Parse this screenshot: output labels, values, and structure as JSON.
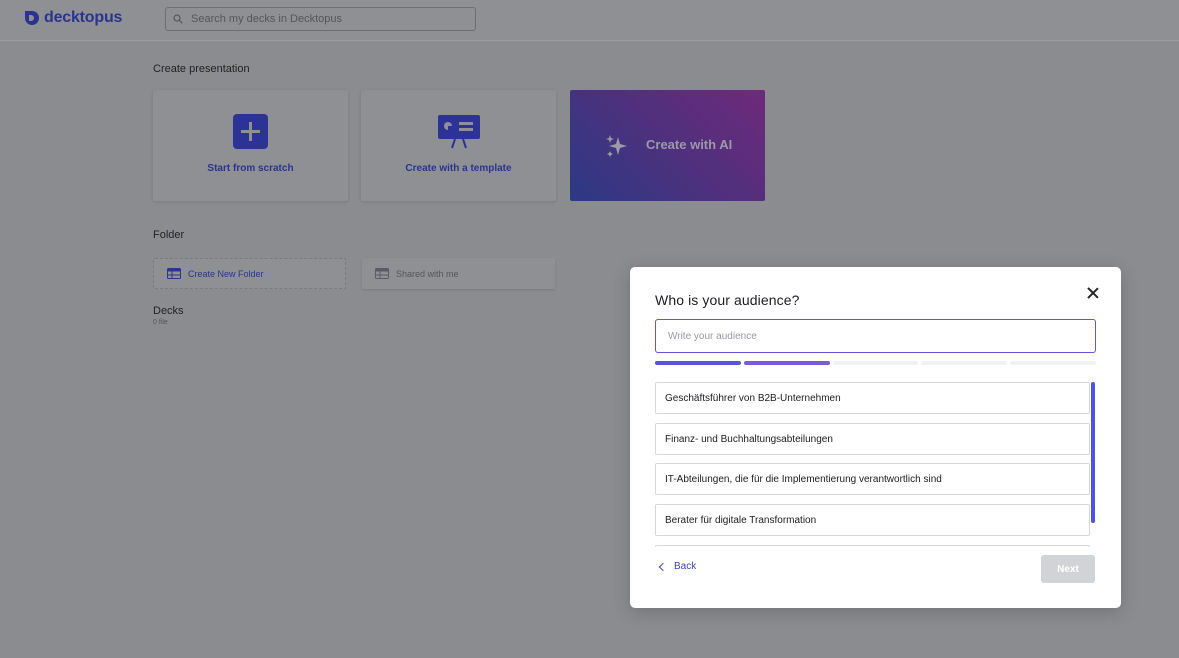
{
  "app": {
    "logo_text": "decktopus"
  },
  "search": {
    "placeholder": "Search my decks in Decktopus",
    "icon": "search-icon"
  },
  "create": {
    "title": "Create presentation",
    "cards": [
      {
        "label": "Start from scratch",
        "icon": "plus-icon"
      },
      {
        "label": "Create with a template",
        "icon": "presentation-board-icon"
      },
      {
        "label": "Create with AI",
        "icon": "sparkles-icon"
      }
    ]
  },
  "folder": {
    "title": "Folder",
    "create_label": "Create New Folder",
    "shared_label": "Shared with me"
  },
  "decks": {
    "title": "Decks",
    "count": "0 file"
  },
  "modal": {
    "title": "Who is your audience?",
    "input_placeholder": "Write your audience",
    "input_value": "",
    "progress": {
      "total_steps": 5,
      "completed_steps": 2
    },
    "options": [
      "Geschäftsführer von B2B-Unternehmen",
      "Finanz- und Buchhaltungsabteilungen",
      "IT-Abteilungen, die für die Implementierung verantwortlich sind",
      "Berater für digitale Transformation",
      ""
    ],
    "back_label": "Back",
    "next_label": "Next"
  },
  "colors": {
    "brand": "#2b3390",
    "accent": "#6c51d6",
    "overlay": "#8b8c8f",
    "next_disabled": "#d2d3d6"
  }
}
